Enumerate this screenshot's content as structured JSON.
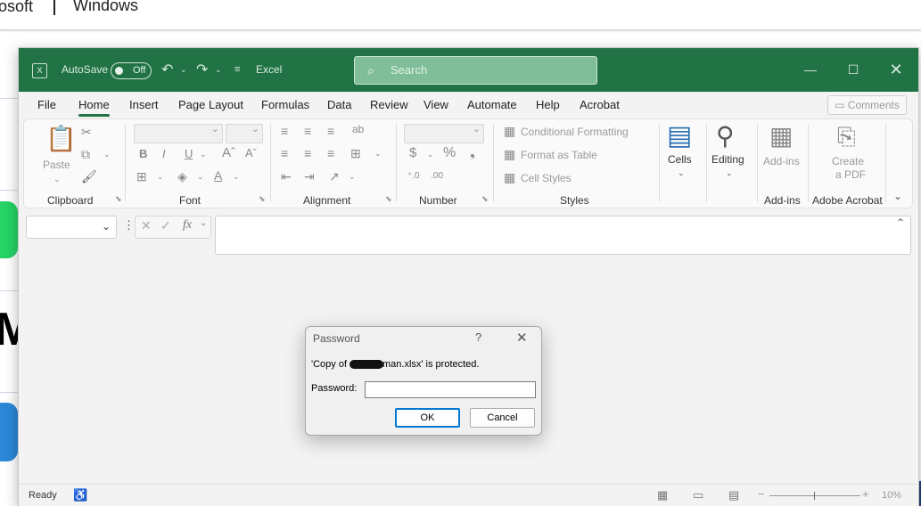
{
  "site": {
    "brand_partial": "osoft",
    "product": "Windows"
  },
  "titlebar": {
    "app_icon": "excel-icon",
    "autosave_label": "AutoSave",
    "autosave_state": "Off",
    "app_name": "Excel",
    "search_placeholder": "Search",
    "controls": [
      "minimize-icon",
      "maximize-icon",
      "close-icon"
    ]
  },
  "ribbon_tabs": [
    "File",
    "Home",
    "Insert",
    "Page Layout",
    "Formulas",
    "Data",
    "Review",
    "View",
    "Automate",
    "Help",
    "Acrobat"
  ],
  "active_tab": "Home",
  "comments_button": "Comments",
  "ribbon": {
    "clipboard": {
      "label": "Clipboard",
      "paste": "Paste"
    },
    "font": {
      "label": "Font",
      "bold": "B",
      "italic": "I",
      "underline": "U"
    },
    "alignment": {
      "label": "Alignment"
    },
    "number": {
      "label": "Number",
      "currency": "$",
      "percent": "%"
    },
    "styles": {
      "label": "Styles",
      "conditional_formatting": "Conditional Formatting",
      "format_as_table": "Format as Table",
      "cell_styles": "Cell Styles"
    },
    "cells": {
      "label": "Cells"
    },
    "editing": {
      "label": "Editing"
    },
    "addins": {
      "label": "Add-ins",
      "button": "Add-ins"
    },
    "acrobat": {
      "label": "Adobe Acrobat",
      "button_line1": "Create",
      "button_line2": "a PDF"
    }
  },
  "formula_bar": {
    "fx": "fx"
  },
  "status": {
    "ready": "Ready",
    "zoom": "10%"
  },
  "dialog": {
    "title": "Password",
    "help": "?",
    "message_prefix": "'Copy of",
    "message_suffix": "man.xlsx' is protected.",
    "password_label": "Password:",
    "ok": "OK",
    "cancel": "Cancel"
  }
}
